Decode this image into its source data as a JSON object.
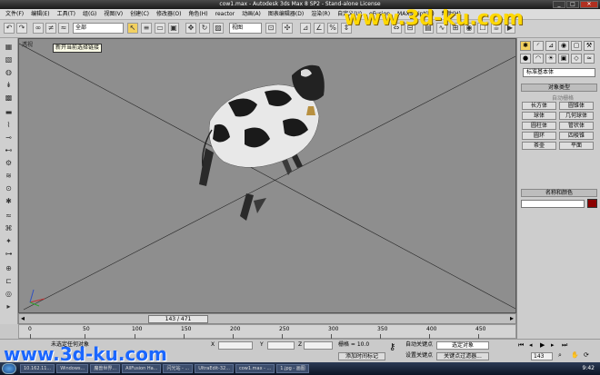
{
  "window": {
    "title": "cow1.max - Autodesk 3ds Max 8 SP2 - Stand-alone License",
    "min": "_",
    "max": "□",
    "close": "✕"
  },
  "menu": [
    "文件(F)",
    "编辑(E)",
    "工具(T)",
    "组(G)",
    "视图(V)",
    "创建(C)",
    "修改器(O)",
    "角色(H)",
    "reactor",
    "动画(A)",
    "图表编辑器(D)",
    "渲染(R)",
    "自定义(U)",
    "oFusion",
    "MAXScript(M)",
    "帮助(H)"
  ],
  "toolbar": {
    "selection_filter": "全部",
    "coord_system": "视图"
  },
  "viewport": {
    "label": "透视",
    "tooltip": "新开当前选择链接"
  },
  "timeslider": {
    "frame_label": "143 / 471"
  },
  "trackbar": {
    "ticks": [
      "0",
      "50",
      "100",
      "150",
      "200",
      "250",
      "300",
      "350",
      "400",
      "450"
    ]
  },
  "command_panel": {
    "category_dropdown": "标准基本体",
    "object_type_header": "对象类型",
    "autogrid_label": "自动栅格",
    "buttons": [
      "长方体",
      "圆锥体",
      "球体",
      "几何球体",
      "圆柱体",
      "管状体",
      "圆环",
      "四棱锥",
      "茶壶",
      "平面"
    ],
    "name_color_header": "名称和颜色",
    "name_color": "#8b0000"
  },
  "status": {
    "selection": "未选定任何对象",
    "x_label": "X",
    "y_label": "Y",
    "z_label": "Z",
    "grid": "栅格 = 10.0",
    "add_time_tag": "添加时间标记",
    "auto_key": "自动关键点",
    "selected_objects": "选定对象",
    "set_key": "设置关键点",
    "key_filters": "关键点过滤器...",
    "frame": "143"
  },
  "taskbar": {
    "tasks": [
      "10.162.11...",
      "Windows...",
      "魔兽世界...",
      "AllFusion Ha...",
      "闪光站 - ...",
      "UltraEdit-32...",
      "cow1.max - ...",
      "1.jpg - 画图"
    ],
    "clock": "9:42"
  },
  "watermark": {
    "top": "www.3d-ku.com",
    "bottom": "www.3d-ku.com"
  }
}
